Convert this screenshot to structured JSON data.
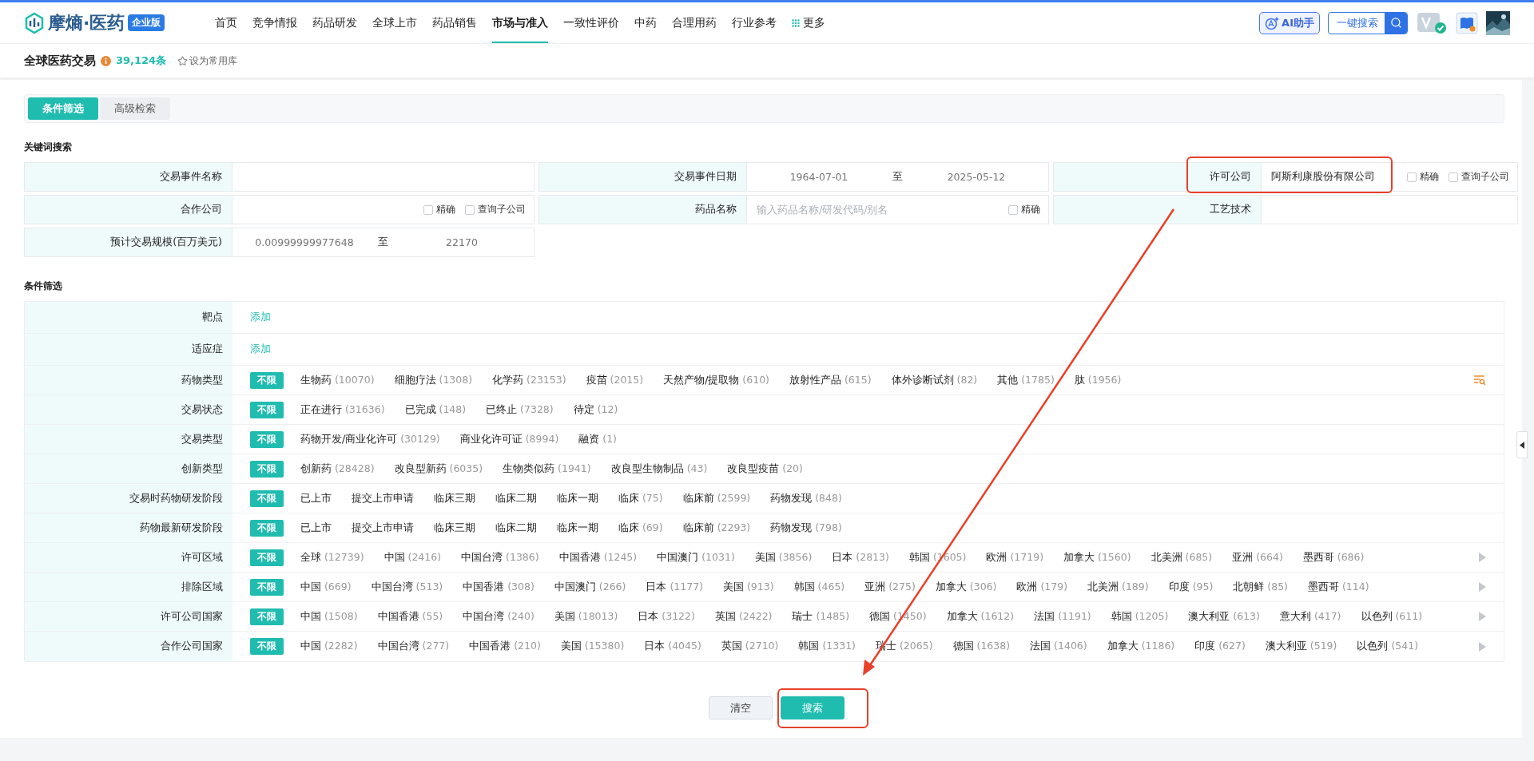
{
  "logo": {
    "name": "摩熵·医药",
    "badge": "企业版"
  },
  "nav": [
    {
      "label": "首页",
      "kind": "link",
      "selected": false
    },
    {
      "label": "竞争情报",
      "kind": "link",
      "selected": false
    },
    {
      "label": "药品研发",
      "kind": "link",
      "selected": false
    },
    {
      "label": "全球上市",
      "kind": "link",
      "selected": false
    },
    {
      "label": "药品销售",
      "kind": "link",
      "selected": false
    },
    {
      "label": "市场与准入",
      "kind": "link",
      "selected": true
    },
    {
      "label": "一致性评价",
      "kind": "link",
      "selected": false
    },
    {
      "label": "中药",
      "kind": "link",
      "selected": false
    },
    {
      "label": "合理用药",
      "kind": "link",
      "selected": false
    },
    {
      "label": "行业参考",
      "kind": "link",
      "selected": false
    },
    {
      "label": "更多",
      "kind": "more",
      "selected": false
    }
  ],
  "toolbar": {
    "ai_button": "AI助手",
    "search_button": "一键搜索"
  },
  "page": {
    "title": "全球医药交易",
    "count": "39,124条",
    "favorite": "设为常用库"
  },
  "tabs": [
    {
      "label": "条件筛选",
      "selected": true
    },
    {
      "label": "高级检索",
      "selected": false
    }
  ],
  "keyword_section": {
    "title": "关键词搜索",
    "fields": [
      {
        "label": "交易事件名称",
        "kind": "text"
      },
      {
        "label": "交易事件日期",
        "kind": "range",
        "from": {
          "placeholder": "1964-07-01"
        },
        "separator": "至",
        "to": {
          "placeholder": "2025-05-12"
        }
      },
      {
        "label": "许可公司",
        "kind": "text",
        "value": "阿斯利康股份有限公司",
        "checkboxes": [
          {
            "label": "精确",
            "checked": false
          },
          {
            "label": "查询子公司",
            "checked": false
          }
        ],
        "highlighted": true
      },
      {
        "label": "合作公司",
        "kind": "text",
        "checkboxes": [
          {
            "label": "精确",
            "checked": false
          },
          {
            "label": "查询子公司",
            "checked": false
          }
        ]
      },
      {
        "label": "药品名称",
        "kind": "text",
        "placeholder": "输入药品名称/研发代码/别名",
        "checkboxes": [
          {
            "label": "精确",
            "checked": false
          }
        ]
      },
      {
        "label": "工艺技术",
        "kind": "text"
      },
      {
        "label": "预计交易规模(百万美元)",
        "kind": "range",
        "from": {
          "placeholder": "0.00999999977648"
        },
        "separator": "至",
        "to": {
          "placeholder": "22170"
        }
      }
    ]
  },
  "filter_section": {
    "title": "条件筛选",
    "rows": [
      {
        "label": "靶点",
        "kind": "add",
        "action": "添加"
      },
      {
        "label": "适应症",
        "kind": "add",
        "action": "添加"
      },
      {
        "label": "药物类型",
        "kind": "options",
        "filter_icon": true,
        "options": [
          {
            "label": "不限",
            "selected": true
          },
          {
            "label": "生物药",
            "count": "(10070)",
            "selected": false
          },
          {
            "label": "细胞疗法",
            "count": "(1308)",
            "selected": false
          },
          {
            "label": "化学药",
            "count": "(23153)",
            "selected": false
          },
          {
            "label": "疫苗",
            "count": "(2015)",
            "selected": false
          },
          {
            "label": "天然产物/提取物",
            "count": "(610)",
            "selected": false
          },
          {
            "label": "放射性产品",
            "count": "(615)",
            "selected": false
          },
          {
            "label": "体外诊断试剂",
            "count": "(82)",
            "selected": false
          },
          {
            "label": "其他",
            "count": "(1785)",
            "selected": false
          },
          {
            "label": "肽",
            "count": "(1956)",
            "selected": false
          }
        ]
      },
      {
        "label": "交易状态",
        "kind": "options",
        "options": [
          {
            "label": "不限",
            "selected": true
          },
          {
            "label": "正在进行",
            "count": "(31636)",
            "selected": false
          },
          {
            "label": "已完成",
            "count": "(148)",
            "selected": false
          },
          {
            "label": "已终止",
            "count": "(7328)",
            "selected": false
          },
          {
            "label": "待定",
            "count": "(12)",
            "selected": false
          }
        ]
      },
      {
        "label": "交易类型",
        "kind": "options",
        "options": [
          {
            "label": "不限",
            "selected": true
          },
          {
            "label": "药物开发/商业化许可",
            "count": "(30129)",
            "selected": false
          },
          {
            "label": "商业化许可证",
            "count": "(8994)",
            "selected": false
          },
          {
            "label": "融资",
            "count": "(1)",
            "selected": false
          }
        ]
      },
      {
        "label": "创新类型",
        "kind": "options",
        "options": [
          {
            "label": "不限",
            "selected": true
          },
          {
            "label": "创新药",
            "count": "(28428)",
            "selected": false
          },
          {
            "label": "改良型新药",
            "count": "(6035)",
            "selected": false
          },
          {
            "label": "生物类似药",
            "count": "(1941)",
            "selected": false
          },
          {
            "label": "改良型生物制品",
            "count": "(43)",
            "selected": false
          },
          {
            "label": "改良型疫苗",
            "count": "(20)",
            "selected": false
          }
        ]
      },
      {
        "label": "交易时药物研发阶段",
        "kind": "options",
        "options": [
          {
            "label": "不限",
            "selected": true
          },
          {
            "label": "已上市",
            "selected": false
          },
          {
            "label": "提交上市申请",
            "selected": false
          },
          {
            "label": "临床三期",
            "selected": false
          },
          {
            "label": "临床二期",
            "selected": false
          },
          {
            "label": "临床一期",
            "selected": false
          },
          {
            "label": "临床",
            "count": "(75)",
            "selected": false
          },
          {
            "label": "临床前",
            "count": "(2599)",
            "selected": false
          },
          {
            "label": "药物发现",
            "count": "(848)",
            "selected": false
          }
        ]
      },
      {
        "label": "药物最新研发阶段",
        "kind": "options",
        "options": [
          {
            "label": "不限",
            "selected": true
          },
          {
            "label": "已上市",
            "selected": false
          },
          {
            "label": "提交上市申请",
            "selected": false
          },
          {
            "label": "临床三期",
            "selected": false
          },
          {
            "label": "临床二期",
            "selected": false
          },
          {
            "label": "临床一期",
            "selected": false
          },
          {
            "label": "临床",
            "count": "(69)",
            "selected": false
          },
          {
            "label": "临床前",
            "count": "(2293)",
            "selected": false
          },
          {
            "label": "药物发现",
            "count": "(798)",
            "selected": false
          }
        ]
      },
      {
        "label": "许可区域",
        "kind": "options",
        "more_arrow": true,
        "options": [
          {
            "label": "不限",
            "selected": true
          },
          {
            "label": "全球",
            "count": "(12739)",
            "selected": false
          },
          {
            "label": "中国",
            "count": "(2416)",
            "selected": false
          },
          {
            "label": "中国台湾",
            "count": "(1386)",
            "selected": false
          },
          {
            "label": "中国香港",
            "count": "(1245)",
            "selected": false
          },
          {
            "label": "中国澳门",
            "count": "(1031)",
            "selected": false
          },
          {
            "label": "美国",
            "count": "(3856)",
            "selected": false
          },
          {
            "label": "日本",
            "count": "(2813)",
            "selected": false
          },
          {
            "label": "韩国",
            "count": "(1605)",
            "selected": false
          },
          {
            "label": "欧洲",
            "count": "(1719)",
            "selected": false
          },
          {
            "label": "加拿大",
            "count": "(1560)",
            "selected": false
          },
          {
            "label": "北美洲",
            "count": "(685)",
            "selected": false
          },
          {
            "label": "亚洲",
            "count": "(664)",
            "selected": false
          },
          {
            "label": "墨西哥",
            "count": "(686)",
            "selected": false
          }
        ]
      },
      {
        "label": "排除区域",
        "kind": "options",
        "more_arrow": true,
        "options": [
          {
            "label": "不限",
            "selected": true
          },
          {
            "label": "中国",
            "count": "(669)",
            "selected": false
          },
          {
            "label": "中国台湾",
            "count": "(513)",
            "selected": false
          },
          {
            "label": "中国香港",
            "count": "(308)",
            "selected": false
          },
          {
            "label": "中国澳门",
            "count": "(266)",
            "selected": false
          },
          {
            "label": "日本",
            "count": "(1177)",
            "selected": false
          },
          {
            "label": "美国",
            "count": "(913)",
            "selected": false
          },
          {
            "label": "韩国",
            "count": "(465)",
            "selected": false
          },
          {
            "label": "亚洲",
            "count": "(275)",
            "selected": false
          },
          {
            "label": "加拿大",
            "count": "(306)",
            "selected": false
          },
          {
            "label": "欧洲",
            "count": "(179)",
            "selected": false
          },
          {
            "label": "北美洲",
            "count": "(189)",
            "selected": false
          },
          {
            "label": "印度",
            "count": "(95)",
            "selected": false
          },
          {
            "label": "北朝鲜",
            "count": "(85)",
            "selected": false
          },
          {
            "label": "墨西哥",
            "count": "(114)",
            "selected": false
          }
        ]
      },
      {
        "label": "许可公司国家",
        "kind": "options",
        "more_arrow": true,
        "options": [
          {
            "label": "不限",
            "selected": true
          },
          {
            "label": "中国",
            "count": "(1508)",
            "selected": false
          },
          {
            "label": "中国香港",
            "count": "(55)",
            "selected": false
          },
          {
            "label": "中国台湾",
            "count": "(240)",
            "selected": false
          },
          {
            "label": "美国",
            "count": "(18013)",
            "selected": false
          },
          {
            "label": "日本",
            "count": "(3122)",
            "selected": false
          },
          {
            "label": "英国",
            "count": "(2422)",
            "selected": false
          },
          {
            "label": "瑞士",
            "count": "(1485)",
            "selected": false
          },
          {
            "label": "德国",
            "count": "(1450)",
            "selected": false
          },
          {
            "label": "加拿大",
            "count": "(1612)",
            "selected": false
          },
          {
            "label": "法国",
            "count": "(1191)",
            "selected": false
          },
          {
            "label": "韩国",
            "count": "(1205)",
            "selected": false
          },
          {
            "label": "澳大利亚",
            "count": "(613)",
            "selected": false
          },
          {
            "label": "意大利",
            "count": "(417)",
            "selected": false
          },
          {
            "label": "以色列",
            "count": "(611)",
            "selected": false
          }
        ]
      },
      {
        "label": "合作公司国家",
        "kind": "options",
        "more_arrow": true,
        "options": [
          {
            "label": "不限",
            "selected": true
          },
          {
            "label": "中国",
            "count": "(2282)",
            "selected": false
          },
          {
            "label": "中国台湾",
            "count": "(277)",
            "selected": false
          },
          {
            "label": "中国香港",
            "count": "(210)",
            "selected": false
          },
          {
            "label": "美国",
            "count": "(15380)",
            "selected": false
          },
          {
            "label": "日本",
            "count": "(4045)",
            "selected": false
          },
          {
            "label": "英国",
            "count": "(2710)",
            "selected": false
          },
          {
            "label": "韩国",
            "count": "(1331)",
            "selected": false
          },
          {
            "label": "瑞士",
            "count": "(2065)",
            "selected": false
          },
          {
            "label": "德国",
            "count": "(1638)",
            "selected": false
          },
          {
            "label": "法国",
            "count": "(1406)",
            "selected": false
          },
          {
            "label": "加拿大",
            "count": "(1186)",
            "selected": false
          },
          {
            "label": "印度",
            "count": "(627)",
            "selected": false
          },
          {
            "label": "澳大利亚",
            "count": "(519)",
            "selected": false
          },
          {
            "label": "以色列",
            "count": "(541)",
            "selected": false
          }
        ]
      }
    ]
  },
  "actions": [
    {
      "label": "清空",
      "kind": "secondary"
    },
    {
      "label": "搜索",
      "kind": "primary",
      "highlighted": true
    }
  ],
  "annotation_arrow": true
}
